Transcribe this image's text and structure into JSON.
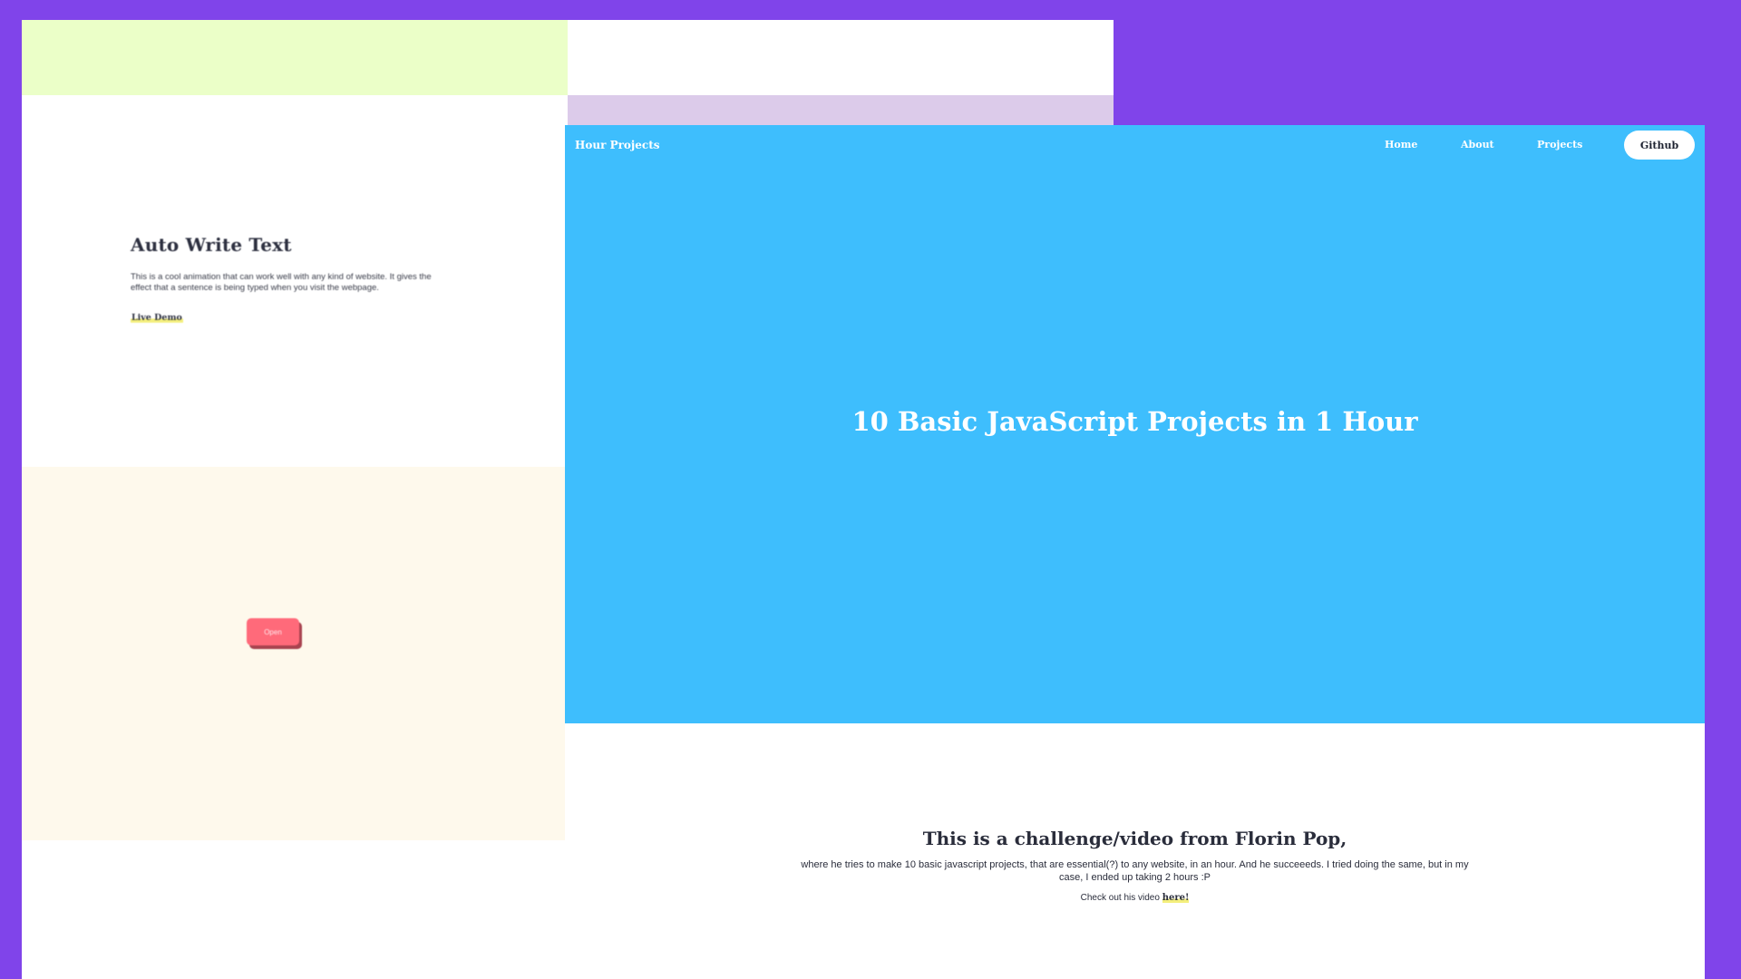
{
  "back_window": {
    "section_title": "Auto Write Text",
    "section_description": "This is a cool animation that can work well with any kind of website. It gives the effect that a sentence is being typed when you visit the webpage.",
    "live_demo_label": "Live Demo",
    "open_button_label": "Open"
  },
  "front_window": {
    "brand": "Hour Projects",
    "nav": {
      "home": "Home",
      "about": "About",
      "projects": "Projects",
      "github": "Github"
    },
    "hero_title": "10 Basic JavaScript Projects in 1 Hour",
    "challenge": {
      "title": "This is a challenge/video from Florin Pop,",
      "description": "where he tries to make 10 basic javascript projects, that are essential(?) to any website, in an hour. And he succeeeds. I tried doing the same, but in my case, I ended up taking 2 hours :P",
      "check_prefix": "Check out his video ",
      "here_link": "here!"
    }
  },
  "colors": {
    "background": "#8044ea",
    "hero": "#3ebefd",
    "lime_panel": "#ebffc8",
    "lilac_panel": "#dccbea",
    "cream_panel": "#fef9ec",
    "open_button": "#ff6a7a",
    "highlight": "#f4ef7d"
  }
}
